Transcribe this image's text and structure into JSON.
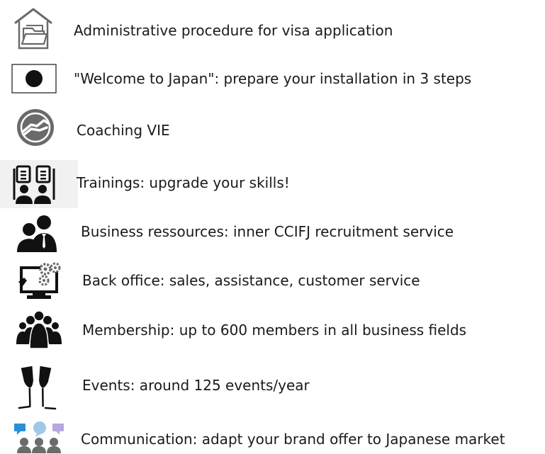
{
  "items": [
    {
      "label": "Administrative procedure for visa application",
      "icon": "house-folder-icon"
    },
    {
      "label": "\"Welcome to Japan\": prepare your installation in 3 steps",
      "icon": "record-dot-icon"
    },
    {
      "label": "Coaching VIE",
      "icon": "handshake-icon"
    },
    {
      "label": "Trainings: upgrade your skills!",
      "icon": "trainees-icon"
    },
    {
      "label": "Business ressources: inner CCIFJ recruitment service",
      "icon": "business-people-icon"
    },
    {
      "label": "Back office: sales, assistance, customer service",
      "icon": "monitor-gears-icon"
    },
    {
      "label": "Membership: up to 600 members in all business fields",
      "icon": "group-icon"
    },
    {
      "label": "Events: around 125 events/year",
      "icon": "champagne-glasses-icon"
    },
    {
      "label": "Communication: adapt your brand offer to Japanese market",
      "icon": "chat-group-icon"
    }
  ],
  "colors": {
    "icon_gray": "#6a6a6a",
    "icon_dark": "#111111",
    "chat_blue": "#2a8fd6",
    "chat_lightblue": "#9ec9ea",
    "chat_purple": "#b8a7e0",
    "people_gray": "#6b6b6b"
  }
}
